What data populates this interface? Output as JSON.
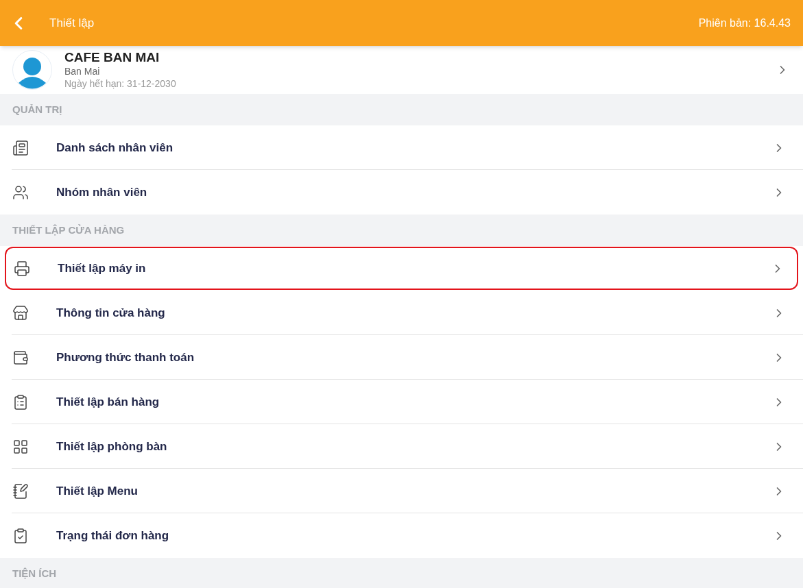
{
  "header": {
    "title": "Thiết lập",
    "version": "Phiên bản: 16.4.43"
  },
  "profile": {
    "name": "CAFE BAN MAI",
    "subtitle": "Ban Mai",
    "expiry": "Ngày hết hạn: 31-12-2030"
  },
  "sections": [
    {
      "title": "QUẢN TRỊ",
      "items": [
        {
          "label": "Danh sách nhân viên",
          "highlighted": false
        },
        {
          "label": "Nhóm nhân viên",
          "highlighted": false
        }
      ]
    },
    {
      "title": "THIẾT LẬP CỬA HÀNG",
      "items": [
        {
          "label": "Thiết lập máy in",
          "highlighted": true
        },
        {
          "label": "Thông tin cửa hàng",
          "highlighted": false
        },
        {
          "label": "Phương thức thanh toán",
          "highlighted": false
        },
        {
          "label": "Thiết lập bán hàng",
          "highlighted": false
        },
        {
          "label": "Thiết lập phòng bàn",
          "highlighted": false
        },
        {
          "label": "Thiết lập Menu",
          "highlighted": false
        },
        {
          "label": "Trạng thái đơn hàng",
          "highlighted": false
        }
      ]
    },
    {
      "title": "TIỆN ÍCH"
    }
  ]
}
